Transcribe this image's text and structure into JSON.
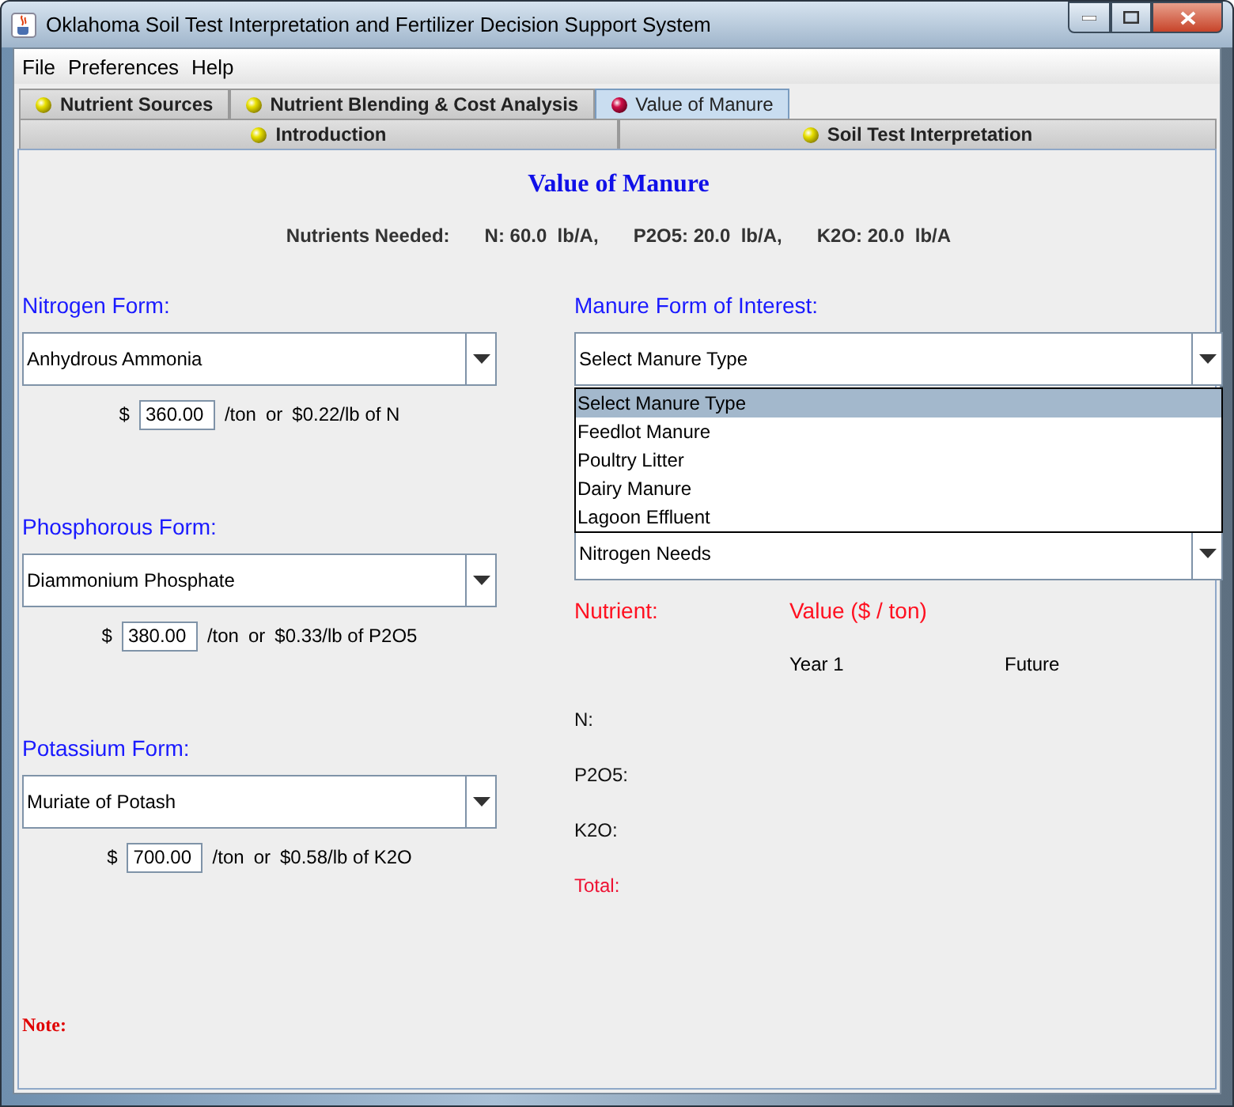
{
  "window": {
    "title": "Oklahoma Soil Test Interpretation and Fertilizer Decision Support System"
  },
  "menu": [
    "File",
    "Preferences",
    "Help"
  ],
  "tabs_top": [
    {
      "label": "Nutrient Sources",
      "selected": false
    },
    {
      "label": "Nutrient Blending & Cost Analysis",
      "selected": false
    },
    {
      "label": "Value of Manure",
      "selected": true
    }
  ],
  "tabs_bottom": [
    {
      "label": "Introduction",
      "selected": false
    },
    {
      "label": "Soil Test Interpretation",
      "selected": false
    }
  ],
  "heading": "Value of Manure",
  "nutrients_needed": {
    "label": "Nutrients Needed:",
    "items": [
      "N: 60.0  lb/A,",
      "P2O5: 20.0  lb/A,",
      "K2O: 20.0  lb/A"
    ]
  },
  "forms": [
    {
      "label": "Nitrogen Form:",
      "value": "Anhydrous Ammonia",
      "currency": "$",
      "price": "360.00",
      "unit": "/ton",
      "or": "or",
      "per_lb": "$0.22/lb of N"
    },
    {
      "label": "Phosphorous Form:",
      "value": "Diammonium Phosphate",
      "currency": "$",
      "price": "380.00",
      "unit": "/ton",
      "or": "or",
      "per_lb": "$0.33/lb of P2O5"
    },
    {
      "label": "Potassium Form:",
      "value": "Muriate of Potash",
      "currency": "$",
      "price": "700.00",
      "unit": "/ton",
      "or": "or",
      "per_lb": "$0.58/lb of K2O"
    }
  ],
  "manure": {
    "label": "Manure Form of Interest:",
    "value": "Select Manure Type",
    "expanded": true,
    "options": [
      {
        "label": "Select Manure Type",
        "selected": true
      },
      {
        "label": "Feedlot Manure",
        "selected": false
      },
      {
        "label": "Poultry Litter",
        "selected": false
      },
      {
        "label": "Dairy Manure",
        "selected": false
      },
      {
        "label": "Lagoon Effluent",
        "selected": false
      }
    ]
  },
  "basis": {
    "value": "Nitrogen Needs"
  },
  "results": {
    "nutrient_header": "Nutrient:",
    "value_header": "Value ($ / ton)",
    "columns": [
      "Year 1",
      "Future"
    ],
    "rows": [
      {
        "label": "N:",
        "kind": "nutrient"
      },
      {
        "label": "P2O5:",
        "kind": "nutrient"
      },
      {
        "label": "K2O:",
        "kind": "nutrient"
      },
      {
        "label": "Total:",
        "kind": "total"
      }
    ]
  },
  "note": "Note:"
}
